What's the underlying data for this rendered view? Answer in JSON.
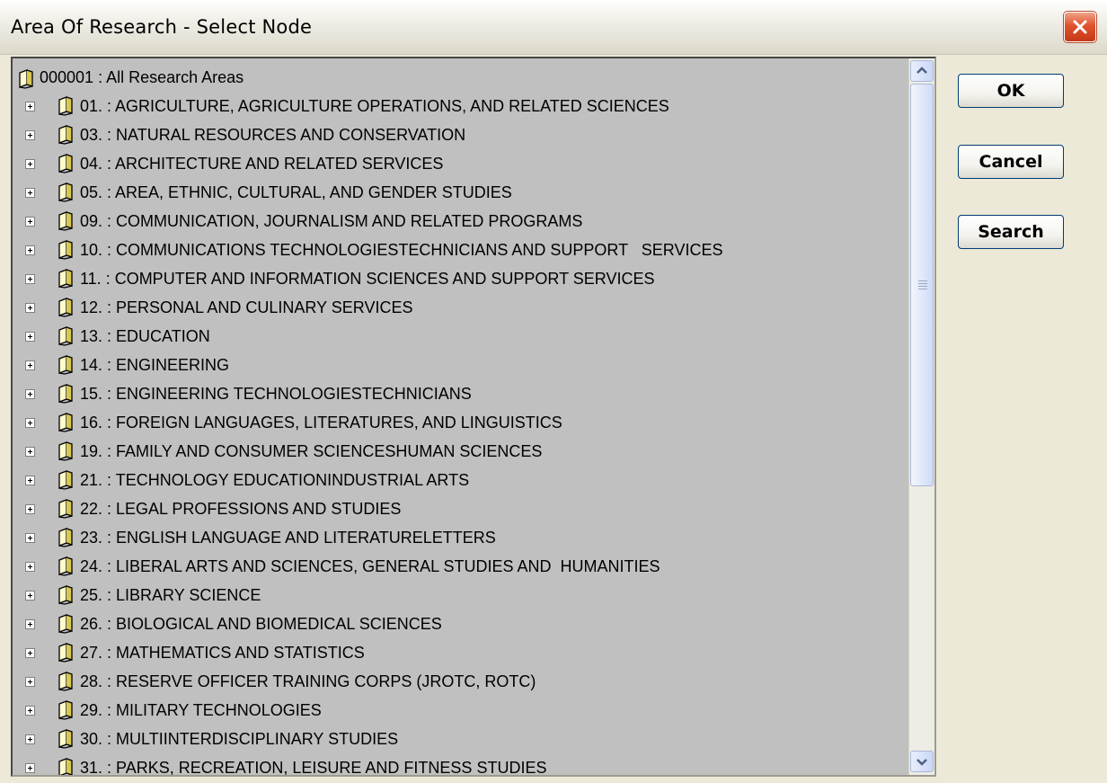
{
  "window": {
    "title": "Area Of Research - Select Node"
  },
  "buttons": {
    "ok": "OK",
    "cancel": "Cancel",
    "search": "Search"
  },
  "tree": {
    "root": "000001 : All Research Areas",
    "items": [
      "01. : AGRICULTURE, AGRICULTURE OPERATIONS, AND RELATED SCIENCES",
      "03. : NATURAL RESOURCES AND CONSERVATION",
      "04. : ARCHITECTURE AND RELATED SERVICES",
      "05. : AREA, ETHNIC, CULTURAL, AND GENDER STUDIES",
      "09. : COMMUNICATION, JOURNALISM AND RELATED PROGRAMS",
      "10. : COMMUNICATIONS TECHNOLOGIESTECHNICIANS AND SUPPORT   SERVICES",
      "11. : COMPUTER AND INFORMATION SCIENCES AND SUPPORT SERVICES",
      "12. : PERSONAL AND CULINARY SERVICES",
      "13. : EDUCATION",
      "14. : ENGINEERING",
      "15. : ENGINEERING TECHNOLOGIESTECHNICIANS",
      "16. : FOREIGN LANGUAGES, LITERATURES, AND LINGUISTICS",
      "19. : FAMILY AND CONSUMER SCIENCESHUMAN SCIENCES",
      "21. : TECHNOLOGY EDUCATIONINDUSTRIAL ARTS",
      "22. : LEGAL PROFESSIONS AND STUDIES",
      "23. : ENGLISH LANGUAGE AND LITERATURELETTERS",
      "24. : LIBERAL ARTS AND SCIENCES, GENERAL STUDIES AND  HUMANITIES",
      "25. : LIBRARY SCIENCE",
      "26. : BIOLOGICAL AND BIOMEDICAL SCIENCES",
      "27. : MATHEMATICS AND STATISTICS",
      "28. : RESERVE OFFICER TRAINING CORPS (JROTC, ROTC)",
      "29. : MILITARY TECHNOLOGIES",
      "30. : MULTIINTERDISCIPLINARY STUDIES",
      "31. : PARKS, RECREATION, LEISURE AND FITNESS STUDIES"
    ]
  },
  "icons": {
    "close": "close-icon",
    "node": "book-icon",
    "expand": "expand-plus-icon",
    "scroll_up": "arrow-up-icon",
    "scroll_down": "arrow-down-icon"
  },
  "colors": {
    "tree_background": "#c0c0c0",
    "window_background": "#ece9d8",
    "close_button": "#e0532c",
    "button_border": "#003c74"
  }
}
